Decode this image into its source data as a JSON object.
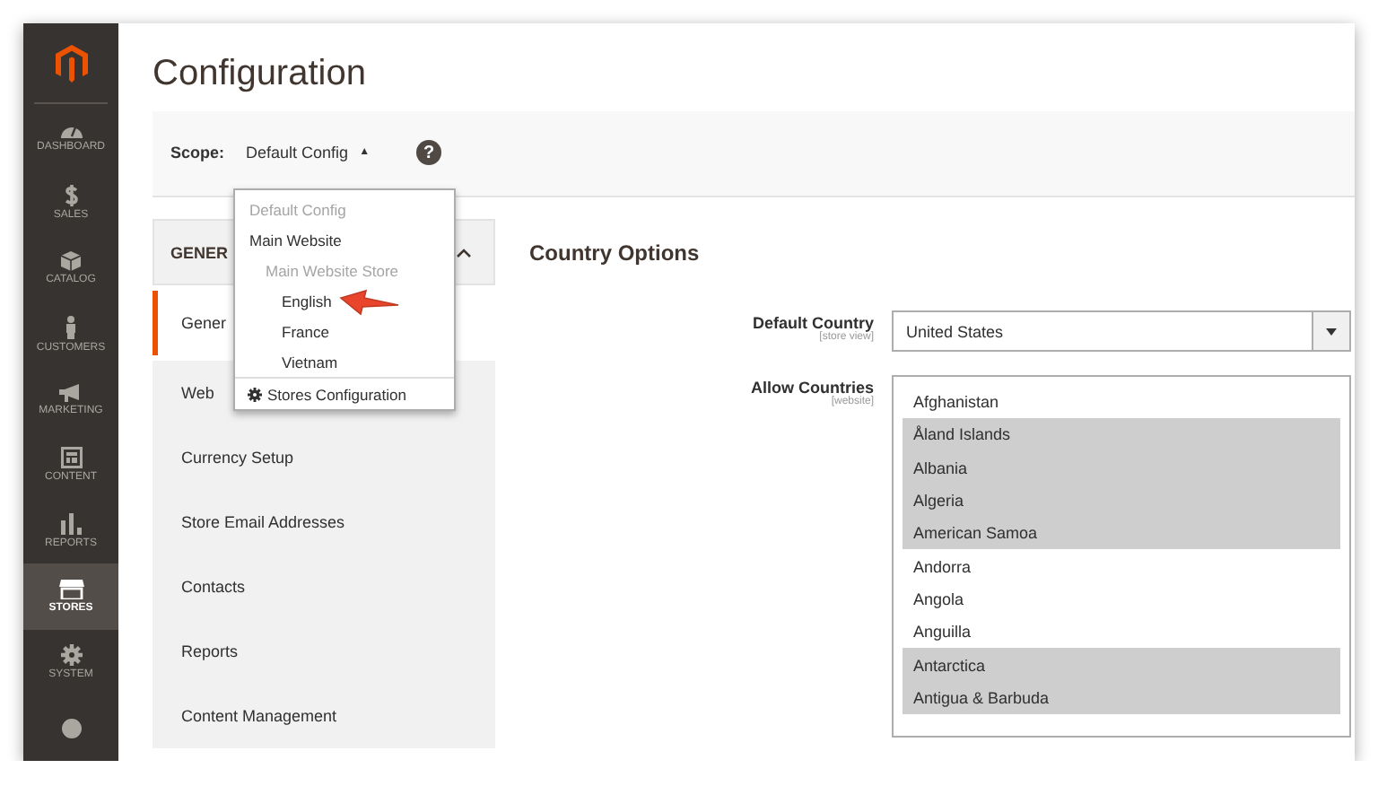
{
  "sidebar": {
    "items": [
      {
        "label": "DASHBOARD",
        "selected": false
      },
      {
        "label": "SALES",
        "selected": false
      },
      {
        "label": "CATALOG",
        "selected": false
      },
      {
        "label": "CUSTOMERS",
        "selected": false
      },
      {
        "label": "MARKETING",
        "selected": false
      },
      {
        "label": "CONTENT",
        "selected": false
      },
      {
        "label": "REPORTS",
        "selected": false
      },
      {
        "label": "STORES",
        "selected": true
      },
      {
        "label": "SYSTEM",
        "selected": false
      }
    ]
  },
  "page_title": "Configuration",
  "scope": {
    "label": "Scope:",
    "value": "Default Config",
    "caret": "▲",
    "help": "?"
  },
  "scope_menu": {
    "items": [
      {
        "label": "Default Config",
        "disabled": true
      },
      {
        "label": "Main Website",
        "disabled": false,
        "children": [
          {
            "label": "Main Website Store",
            "disabled": true,
            "children": [
              {
                "label": "English",
                "disabled": false
              },
              {
                "label": "France",
                "disabled": false
              },
              {
                "label": "Vietnam",
                "disabled": false
              }
            ]
          }
        ]
      }
    ],
    "footer": "Stores Configuration"
  },
  "config_nav": {
    "header": "GENER",
    "items": [
      {
        "label": "Gener",
        "selected": true
      },
      {
        "label": "Web",
        "selected": false
      },
      {
        "label": "Currency Setup",
        "selected": false
      },
      {
        "label": "Store Email Addresses",
        "selected": false
      },
      {
        "label": "Contacts",
        "selected": false
      },
      {
        "label": "Reports",
        "selected": false
      },
      {
        "label": "Content Management",
        "selected": false
      }
    ]
  },
  "section": {
    "title": "Country Options",
    "default_country": {
      "label": "Default Country",
      "scope": "[store view]",
      "value": "United States"
    },
    "allow_countries": {
      "label": "Allow Countries",
      "scope": "[website]",
      "options": [
        {
          "label": "Afghanistan",
          "selected": false
        },
        {
          "label": "Åland Islands",
          "selected": true
        },
        {
          "label": "Albania",
          "selected": true
        },
        {
          "label": "Algeria",
          "selected": true
        },
        {
          "label": "American Samoa",
          "selected": true
        },
        {
          "label": "Andorra",
          "selected": false
        },
        {
          "label": "Angola",
          "selected": false
        },
        {
          "label": "Anguilla",
          "selected": false
        },
        {
          "label": "Antarctica",
          "selected": true
        },
        {
          "label": "Antigua & Barbuda",
          "selected": true
        }
      ]
    }
  }
}
